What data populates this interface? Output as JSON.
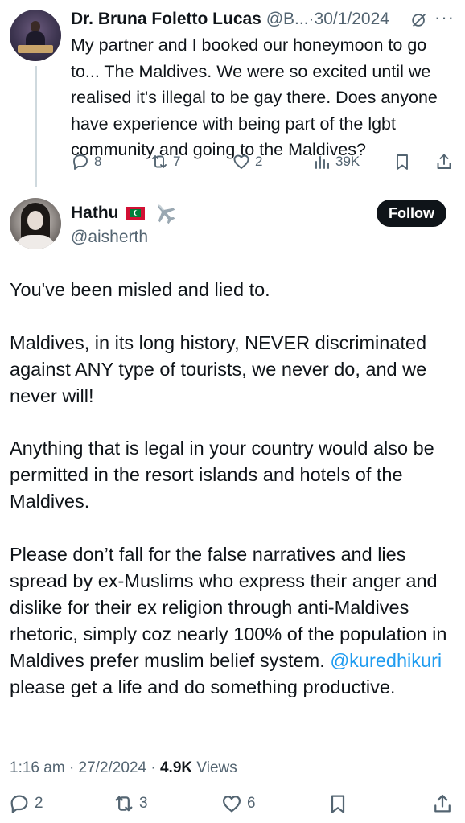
{
  "parent_tweet": {
    "author_name": "Dr. Bruna Foletto Lucas",
    "author_handle": "@B...",
    "separator": "·",
    "date": "30/1/2024",
    "text": "My partner and I booked our honeymoon to go to... The Maldives. We were so excited until we realised it's illegal to be gay there. Does anyone have experience with being part of the lgbt community and going to the Maldives?",
    "replies": "8",
    "reposts": "7",
    "likes": "2",
    "views": "39K",
    "icons": [
      "grok-icon",
      "more-icon",
      "reply-icon",
      "repost-icon",
      "like-icon",
      "views-icon",
      "bookmark-icon",
      "share-icon"
    ]
  },
  "main_tweet": {
    "author_name": "Hathu",
    "author_handle": "@aisherth",
    "badges": [
      "maldives-flag-icon",
      "airplane-icon"
    ],
    "follow_label": "Follow",
    "paragraph_1": "You've been misled and lied to.",
    "paragraph_2": "Maldives, in its long history, NEVER discriminated against ANY type of tourists, we never do, and we never will!",
    "paragraph_3": "Anything that is legal in your country would also be permitted in the resort islands and hotels of the Maldives.",
    "paragraph_4": "Please don’t  fall for the false narratives and lies spread by ex-Muslims who express their anger and dislike for their ex religion through anti-Maldives rhetoric, simply coz nearly 100% of the population in Maldives prefer muslim belief system.",
    "mention": "@kuredhikuri",
    "paragraph_4_tail": " please get a life and do something productive.",
    "time": "1:16 am",
    "date": "27/2/2024",
    "separator": "·",
    "views_count": "4.9K",
    "views_label": "Views",
    "replies": "2",
    "reposts": "3",
    "likes": "6"
  },
  "colors": {
    "text": "#0f1419",
    "secondary": "#536471",
    "link": "#1d9bf0",
    "thread_line": "#cfd9de",
    "button_bg": "#0f1419"
  }
}
